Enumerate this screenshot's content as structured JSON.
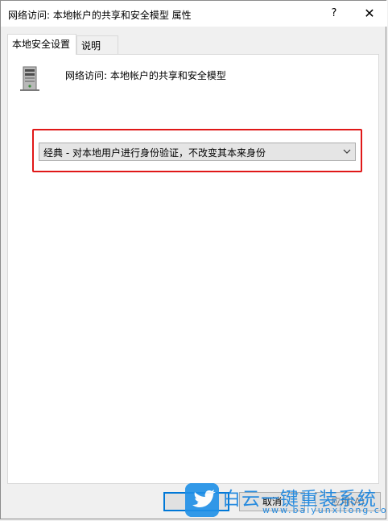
{
  "window": {
    "title": "网络访问: 本地帐户的共享和安全模型 属性",
    "help_glyph": "?",
    "close_glyph": "✕"
  },
  "tabs": [
    {
      "label": "本地安全设置",
      "active": true
    },
    {
      "label": "说明",
      "active": false
    }
  ],
  "panel": {
    "icon": "server-icon",
    "policy_name": "网络访问: 本地帐户的共享和安全模型",
    "dropdown": {
      "selected": "经典 - 对本地用户进行身份验证，不改变其本来身份",
      "arrow_glyph": "⌄"
    }
  },
  "buttons": {
    "ok": "",
    "cancel": "取消",
    "apply": "应用(A)"
  },
  "watermark": {
    "title": "白云一键重装系统",
    "url": "www.baiyunxitong.com"
  },
  "colors": {
    "highlight": "#e01818",
    "focus": "#0078d7",
    "watermark": "#1482de"
  }
}
